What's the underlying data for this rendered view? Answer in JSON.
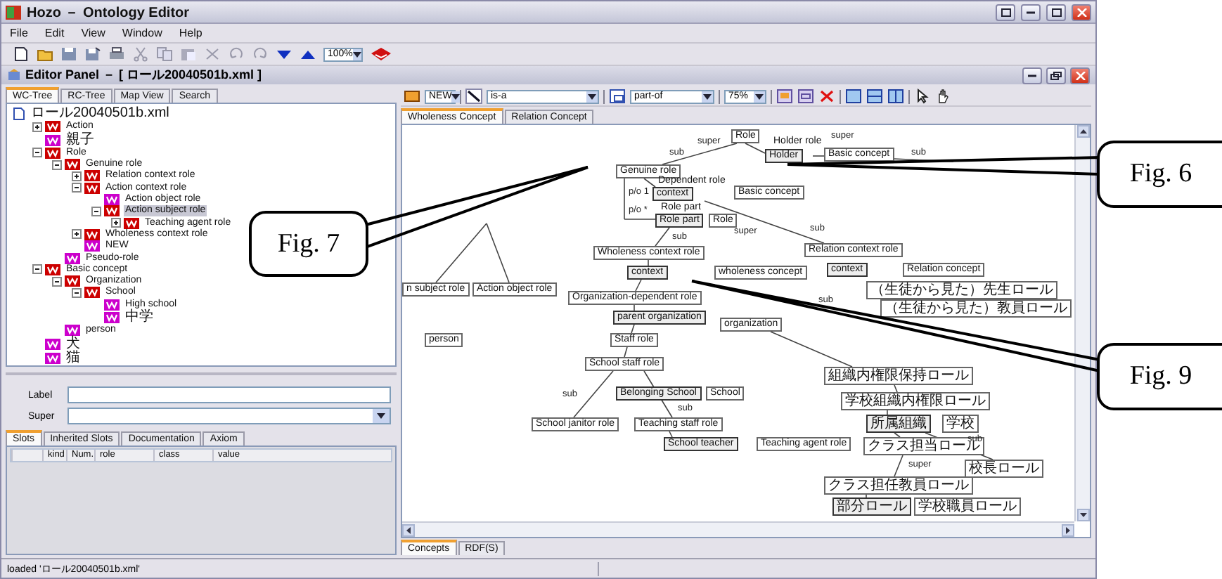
{
  "window": {
    "title": "Hozo － Ontology Editor"
  },
  "menu": [
    "File",
    "Edit",
    "View",
    "Window",
    "Help"
  ],
  "toolbar": {
    "zoom": "100%"
  },
  "editor": {
    "title": "Editor Panel － [ ロール20040501b.xml ]"
  },
  "left_tabs": [
    {
      "label": "WC-Tree",
      "selected": true
    },
    {
      "label": "RC-Tree",
      "selected": false
    },
    {
      "label": "Map View",
      "selected": false
    },
    {
      "label": "Search",
      "selected": false
    }
  ],
  "tree": {
    "label": "ロール20040501b.xml",
    "children": [
      {
        "label": "Action",
        "expanded": false,
        "color": "#cc0000",
        "selected": false
      },
      {
        "label": "親子",
        "color": "#cc00cc",
        "selected": false
      },
      {
        "label": "Role",
        "expanded": true,
        "color": "#cc0000",
        "selected": false,
        "children": [
          {
            "label": "Genuine role",
            "expanded": true,
            "color": "#cc0000",
            "selected": false,
            "children": [
              {
                "label": "Relation context role",
                "expanded": false,
                "color": "#cc0000",
                "selected": false
              },
              {
                "label": "Action context role",
                "expanded": true,
                "color": "#cc0000",
                "selected": false,
                "children": [
                  {
                    "label": "Action object role",
                    "color": "#cc00cc",
                    "selected": false
                  },
                  {
                    "label": "Action subject role",
                    "expanded": true,
                    "color": "#cc0000",
                    "selected": true,
                    "children": [
                      {
                        "label": "Teaching agent role",
                        "expanded": false,
                        "color": "#cc0000",
                        "selected": false
                      }
                    ]
                  }
                ]
              },
              {
                "label": "Wholeness context role",
                "expanded": false,
                "color": "#cc0000",
                "selected": false
              },
              {
                "label": "NEW",
                "color": "#cc00cc",
                "selected": false
              }
            ]
          },
          {
            "label": "Pseudo-role",
            "color": "#cc00cc",
            "selected": false
          }
        ]
      },
      {
        "label": "Basic concept",
        "expanded": true,
        "color": "#cc0000",
        "selected": false,
        "children": [
          {
            "label": "Organization",
            "expanded": true,
            "color": "#cc0000",
            "selected": false,
            "children": [
              {
                "label": "School",
                "expanded": true,
                "color": "#cc0000",
                "selected": false,
                "children": [
                  {
                    "label": "High school",
                    "color": "#cc00cc",
                    "selected": false
                  },
                  {
                    "label": "中学",
                    "color": "#cc00cc",
                    "selected": false
                  }
                ]
              }
            ]
          },
          {
            "label": "person",
            "color": "#cc00cc",
            "selected": false
          }
        ]
      },
      {
        "label": "犬",
        "color": "#cc00cc",
        "selected": false
      },
      {
        "label": "猫",
        "color": "#cc00cc",
        "selected": false
      }
    ]
  },
  "fields": [
    {
      "label": "Label",
      "kind": "text"
    },
    {
      "label": "Super",
      "kind": "combo"
    }
  ],
  "slot_tabs": [
    {
      "label": "Slots",
      "selected": true
    },
    {
      "label": "Inherited Slots",
      "selected": false
    },
    {
      "label": "Documentation",
      "selected": false
    },
    {
      "label": "Axiom",
      "selected": false
    }
  ],
  "slot_columns": [
    "kind",
    "Num.",
    "role",
    "class",
    "value"
  ],
  "canvas_toolbar": {
    "concept": "NEW",
    "is_a": "is-a",
    "part_of": "part-of",
    "zoom": "75%"
  },
  "canvas_tabs": [
    {
      "label": "Wholeness Concept",
      "selected": true
    },
    {
      "label": "Relation Concept",
      "selected": false
    }
  ],
  "nodes": [
    {
      "label": "Role",
      "kind": "box"
    },
    {
      "label": "Holder role",
      "kind": "text"
    },
    {
      "label": "Holder",
      "kind": "slot"
    },
    {
      "label": "Basic concept",
      "kind": "box"
    },
    {
      "label": "Genuine role",
      "kind": "box"
    },
    {
      "label": "Dependent role",
      "kind": "text"
    },
    {
      "label": "context",
      "kind": "slot"
    },
    {
      "label": "Basic concept",
      "kind": "box"
    },
    {
      "label": "Role part",
      "kind": "text"
    },
    {
      "label": "Role part",
      "kind": "slot"
    },
    {
      "label": "Role",
      "kind": "box"
    },
    {
      "label": "Wholeness context role",
      "kind": "box"
    },
    {
      "label": "Relation context role",
      "kind": "box"
    },
    {
      "label": "context",
      "kind": "slot"
    },
    {
      "label": "wholeness concept",
      "kind": "box"
    },
    {
      "label": "context",
      "kind": "slot"
    },
    {
      "label": "Relation concept",
      "kind": "box"
    },
    {
      "label": "n subject role",
      "kind": "box"
    },
    {
      "label": "Action object role",
      "kind": "box"
    },
    {
      "label": "Organization-dependent role",
      "kind": "box"
    },
    {
      "label": "（生徒から見た）先生ロール",
      "kind": "box"
    },
    {
      "label": "parent organization",
      "kind": "slot"
    },
    {
      "label": "organization",
      "kind": "box"
    },
    {
      "label": "（生徒から見た）教員ロール",
      "kind": "box"
    },
    {
      "label": "person",
      "kind": "box"
    },
    {
      "label": "Staff role",
      "kind": "box"
    },
    {
      "label": "School staff role",
      "kind": "box"
    },
    {
      "label": "組織内権限保持ロール",
      "kind": "box"
    },
    {
      "label": "Belonging School",
      "kind": "slot"
    },
    {
      "label": "School",
      "kind": "box"
    },
    {
      "label": "学校組織内権限ロール",
      "kind": "box"
    },
    {
      "label": "School janitor role",
      "kind": "box"
    },
    {
      "label": "Teaching staff role",
      "kind": "box"
    },
    {
      "label": "所属組織",
      "kind": "slot"
    },
    {
      "label": "学校",
      "kind": "box"
    },
    {
      "label": "School teacher",
      "kind": "slot"
    },
    {
      "label": "Teaching agent role",
      "kind": "box"
    },
    {
      "label": "クラス担当ロール",
      "kind": "box"
    },
    {
      "label": "校長ロール",
      "kind": "box"
    },
    {
      "label": "クラス担任教員ロール",
      "kind": "box"
    },
    {
      "label": "部分ロール",
      "kind": "slot"
    },
    {
      "label": "学校職員ロール",
      "kind": "box"
    }
  ],
  "edge_labels": [
    "super",
    "super",
    "sub",
    "sub",
    "p/o 1",
    "p/o *",
    "sub",
    "super",
    "sub",
    "sub",
    "sub",
    "sub",
    "sub",
    "super"
  ],
  "bottom_tabs": [
    {
      "label": "Concepts",
      "selected": true
    },
    {
      "label": "RDF(S)",
      "selected": false
    }
  ],
  "status": "loaded 'ロール20040501b.xml'",
  "callouts": [
    "Fig. 6",
    "Fig. 7",
    "Fig. 9"
  ]
}
